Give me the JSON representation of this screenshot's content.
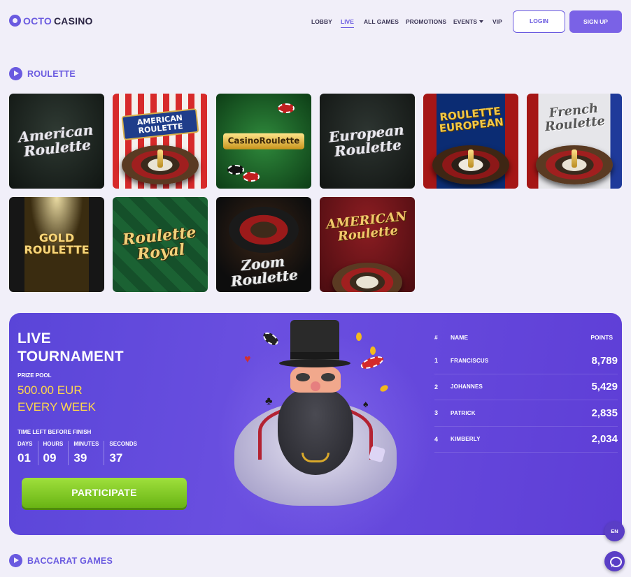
{
  "brand": {
    "part1": "OCTO",
    "part2": "CASINO"
  },
  "nav": {
    "items": [
      {
        "label": "LOBBY",
        "active": false
      },
      {
        "label": "LIVE",
        "active": true
      },
      {
        "label": "ALL GAMES",
        "active": false
      },
      {
        "label": "PROMOTIONS",
        "active": false
      },
      {
        "label": "EVENTS",
        "active": false,
        "dropdown": true
      },
      {
        "label": "VIP",
        "active": false
      }
    ],
    "login": "LOGIN",
    "signup": "SIGN UP"
  },
  "roulette": {
    "title": "ROULETTE",
    "games": [
      {
        "caption": "American Roulette",
        "theme": "dark-table"
      },
      {
        "caption": "AMERICAN ROULETTE",
        "theme": "red-curtain"
      },
      {
        "caption": "CasinoRoulette",
        "theme": "green-gold"
      },
      {
        "caption": "European Roulette",
        "theme": "dark-table"
      },
      {
        "caption": "ROULETTE EUROPEAN",
        "theme": "blue-stars"
      },
      {
        "caption": "French Roulette",
        "theme": "tricolor"
      },
      {
        "caption": "GOLD ROULETTE",
        "theme": "gold-curtain"
      },
      {
        "caption": "Roulette Royal",
        "theme": "green-felt"
      },
      {
        "caption": "Zoom Roulette",
        "theme": "dark-wheel"
      },
      {
        "caption": "AMERICAN Roulette",
        "theme": "maroon"
      }
    ]
  },
  "tournament": {
    "title_line1": "LIVE",
    "title_line2": "TOURNAMENT",
    "prize_label": "PRIZE POOL",
    "prize_line1": "500.00 EUR",
    "prize_line2": "EVERY WEEK",
    "time_label": "TIME LEFT BEFORE FINISH",
    "timer": [
      {
        "label": "DAYS",
        "value": "01"
      },
      {
        "label": "HOURS",
        "value": "09"
      },
      {
        "label": "MINUTES",
        "value": "39"
      },
      {
        "label": "SECONDS",
        "value": "37"
      }
    ],
    "participate": "PARTICIPATE",
    "leaderboard": {
      "headers": {
        "rank": "#",
        "name": "NAME",
        "points": "POINTS"
      },
      "rows": [
        {
          "rank": "1",
          "name": "FRANCISCUS",
          "points": "8,789"
        },
        {
          "rank": "2",
          "name": "JOHANNES",
          "points": "5,429"
        },
        {
          "rank": "3",
          "name": "PATRICK",
          "points": "2,835"
        },
        {
          "rank": "4",
          "name": "KIMBERLY",
          "points": "2,034"
        }
      ]
    }
  },
  "baccarat": {
    "title": "BACCARAT GAMES"
  },
  "floating": {
    "language": "EN"
  },
  "colors": {
    "accent": "#6a5ae0",
    "tournament_bg": "#5a45d8",
    "prize": "#ffd84a",
    "participate": "#7fc520"
  }
}
